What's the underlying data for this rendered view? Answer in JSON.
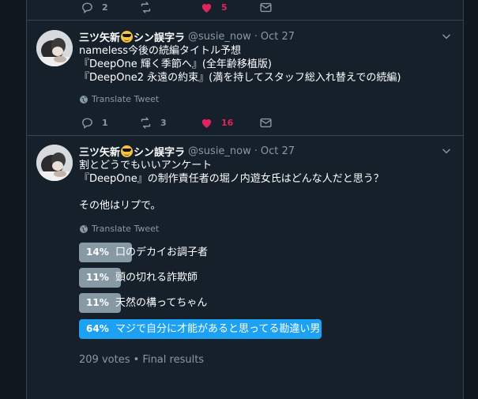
{
  "top_actions": {
    "reply_count": "2",
    "retweet_count": "",
    "like_count": "5"
  },
  "tweet1": {
    "display_name": "三ツ矢新",
    "display_name_suffix": "シン誤字ラ",
    "handle": "@susie_now",
    "dot": "·",
    "date": "Oct 27",
    "lines": [
      "nameless今後の続編タイトル予想",
      "『DeepOne 輝く季節へ』(全年齢移植版)",
      "『DeepOne2 永遠の約束』(満を持してスタッフ総入れ替えでの続編)"
    ],
    "translate": "Translate Tweet",
    "reply_count": "1",
    "retweet_count": "3",
    "like_count": "16"
  },
  "tweet2": {
    "display_name": "三ツ矢新",
    "display_name_suffix": "シン誤字ラ",
    "handle": "@susie_now",
    "dot": "·",
    "date": "Oct 27",
    "lines": [
      "割とどうでもいいアンケート",
      "『DeepOne』の制作責任者の堀ノ内遊女氏はどんな人だと思う？",
      "",
      "その他はリプで。"
    ],
    "translate": "Translate Tweet",
    "poll": {
      "options": [
        {
          "percent_label": "14%",
          "label": "口のデカイお調子者",
          "fraction": 0.14,
          "winner": false
        },
        {
          "percent_label": "11%",
          "label": "頭の切れる詐欺師",
          "fraction": 0.11,
          "winner": false
        },
        {
          "percent_label": "11%",
          "label": "天然の構ってちゃん",
          "fraction": 0.11,
          "winner": false
        },
        {
          "percent_label": "64%",
          "label": "マジで自分に才能があると思ってる勘違い男",
          "fraction": 0.64,
          "winner": true
        }
      ],
      "votes": "209 votes",
      "separator": "•",
      "status": "Final results"
    }
  },
  "colors": {
    "like": "#e0245e",
    "accent": "#1da1f2",
    "muted": "#8899a6",
    "background": "#15202b"
  },
  "icons": [
    "reply-icon",
    "retweet-icon",
    "heart-icon",
    "dm-icon",
    "chevron-down-icon",
    "globe-icon"
  ]
}
